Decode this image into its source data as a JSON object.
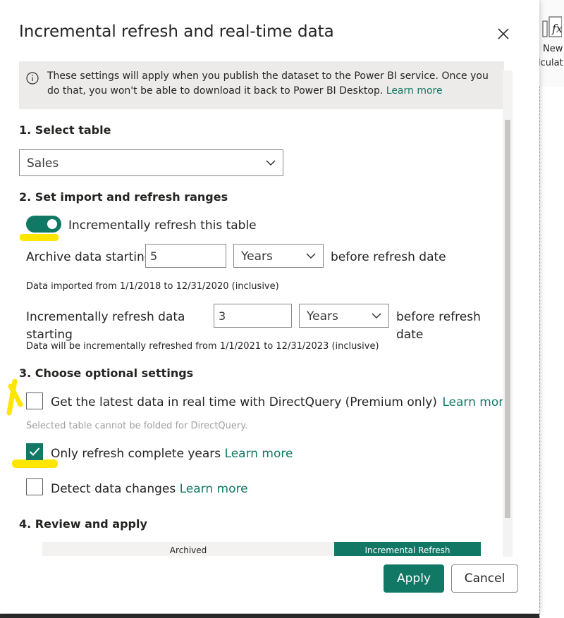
{
  "background": {
    "ribbon_label_1": "New",
    "ribbon_label_2": "lculat"
  },
  "dialog": {
    "title": "Incremental refresh and real-time data",
    "info": {
      "text": "These settings will apply when you publish the dataset to the Power BI service. Once you do that, you won't be able to download it back to Power BI Desktop.",
      "link": "Learn more"
    },
    "section1": {
      "heading": "1. Select table",
      "table_value": "Sales"
    },
    "section2": {
      "heading": "2. Set import and refresh ranges",
      "toggle_label": "Incrementally refresh this table",
      "toggle_on": true,
      "archive_label": "Archive data starting",
      "archive_value": "5",
      "archive_unit": "Years",
      "archive_suffix": "before refresh date",
      "archive_note": "Data imported from 1/1/2018 to 12/31/2020 (inclusive)",
      "incr_label_line1": "Incrementally refresh data",
      "incr_label_line2": "starting",
      "incr_value": "3",
      "incr_unit": "Years",
      "incr_suffix_line1": "before refresh",
      "incr_suffix_line2": "date",
      "incr_note": "Data will be incrementally refreshed from 1/1/2021 to 12/31/2023 (inclusive)"
    },
    "section3": {
      "heading": "3. Choose optional settings",
      "directquery_label": "Get the latest data in real time with DirectQuery (Premium only)",
      "directquery_link": "Learn more",
      "directquery_checked": false,
      "directquery_note": "Selected table cannot be folded for DirectQuery.",
      "complete_years_label": "Only refresh complete years",
      "complete_years_link": "Learn more",
      "complete_years_checked": true,
      "detect_changes_label": "Detect data changes",
      "detect_changes_link": "Learn more",
      "detect_changes_checked": false
    },
    "section4": {
      "heading": "4. Review and apply",
      "archived_label": "Archived",
      "incremental_label": "Incremental Refresh"
    },
    "buttons": {
      "apply": "Apply",
      "cancel": "Cancel"
    }
  },
  "colors": {
    "accent": "#117865",
    "highlight": "#ffe600"
  }
}
